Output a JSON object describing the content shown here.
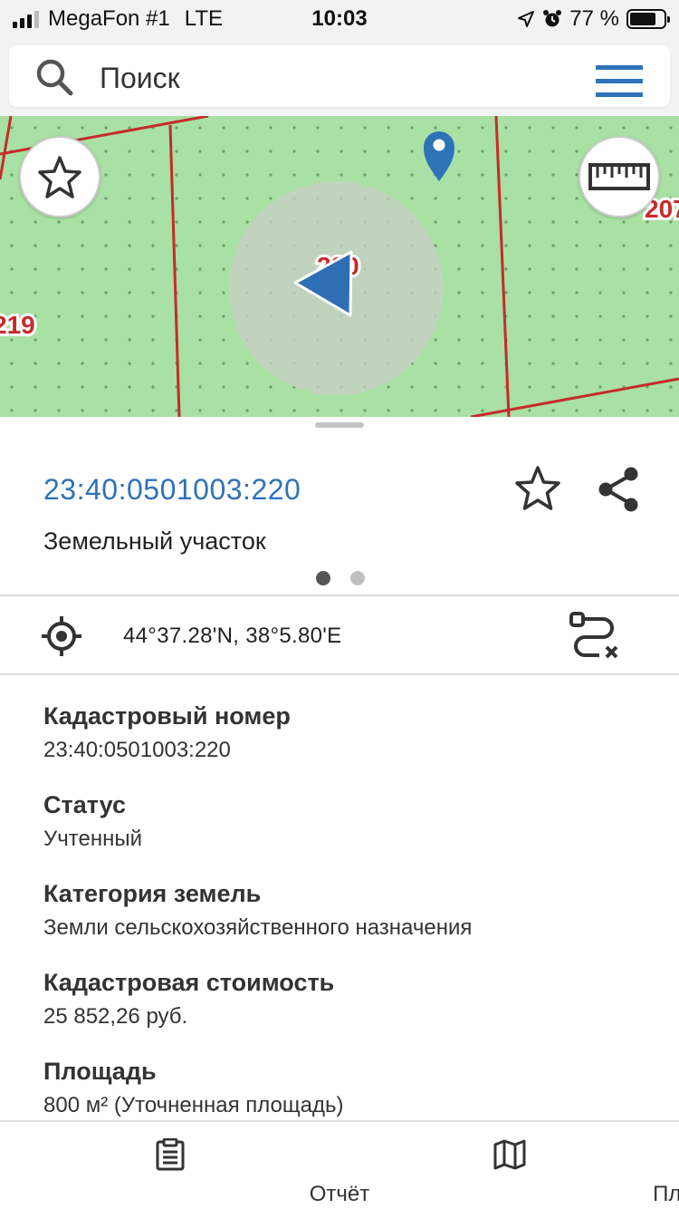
{
  "status_bar": {
    "carrier": "MegaFon #1",
    "network": "LTE",
    "time": "10:03",
    "battery": "77 %",
    "battery_level": 0.77
  },
  "search": {
    "placeholder": "Поиск",
    "search_icon": "search-icon",
    "menu_icon": "hamburger-menu-icon"
  },
  "map": {
    "labels": [
      "220",
      "219",
      "207"
    ],
    "controls": [
      "star-icon",
      "ruler-icon"
    ],
    "pin_icon": "location-pin-icon",
    "position_icon": "navigation-arrow-icon",
    "colors": {
      "parcel_fill": "#a9e0a3",
      "boundary": "#c62b2b",
      "accent": "#2e73b8"
    }
  },
  "parcel": {
    "cadastral_id": "23:40:0501003:220",
    "type": "Земельный участок",
    "page_count": 2,
    "active_page": 1
  },
  "coordinates": {
    "text": "44°37.28'N, 38°5.80'E"
  },
  "properties": [
    {
      "label": "Кадастровый номер",
      "value": "23:40:0501003:220"
    },
    {
      "label": "Статус",
      "value": "Учтенный"
    },
    {
      "label": "Категория земель",
      "value": "Земли сельскохозяйственного назначения"
    },
    {
      "label": "Кадастровая стоимость",
      "value": "25 852,26 руб."
    },
    {
      "label": "Площадь",
      "value": "800 м² (Уточненная площадь)"
    }
  ],
  "tabs": [
    {
      "label": "Отчёт",
      "icon": "clipboard-icon"
    },
    {
      "label": "План",
      "icon": "map-icon"
    }
  ]
}
